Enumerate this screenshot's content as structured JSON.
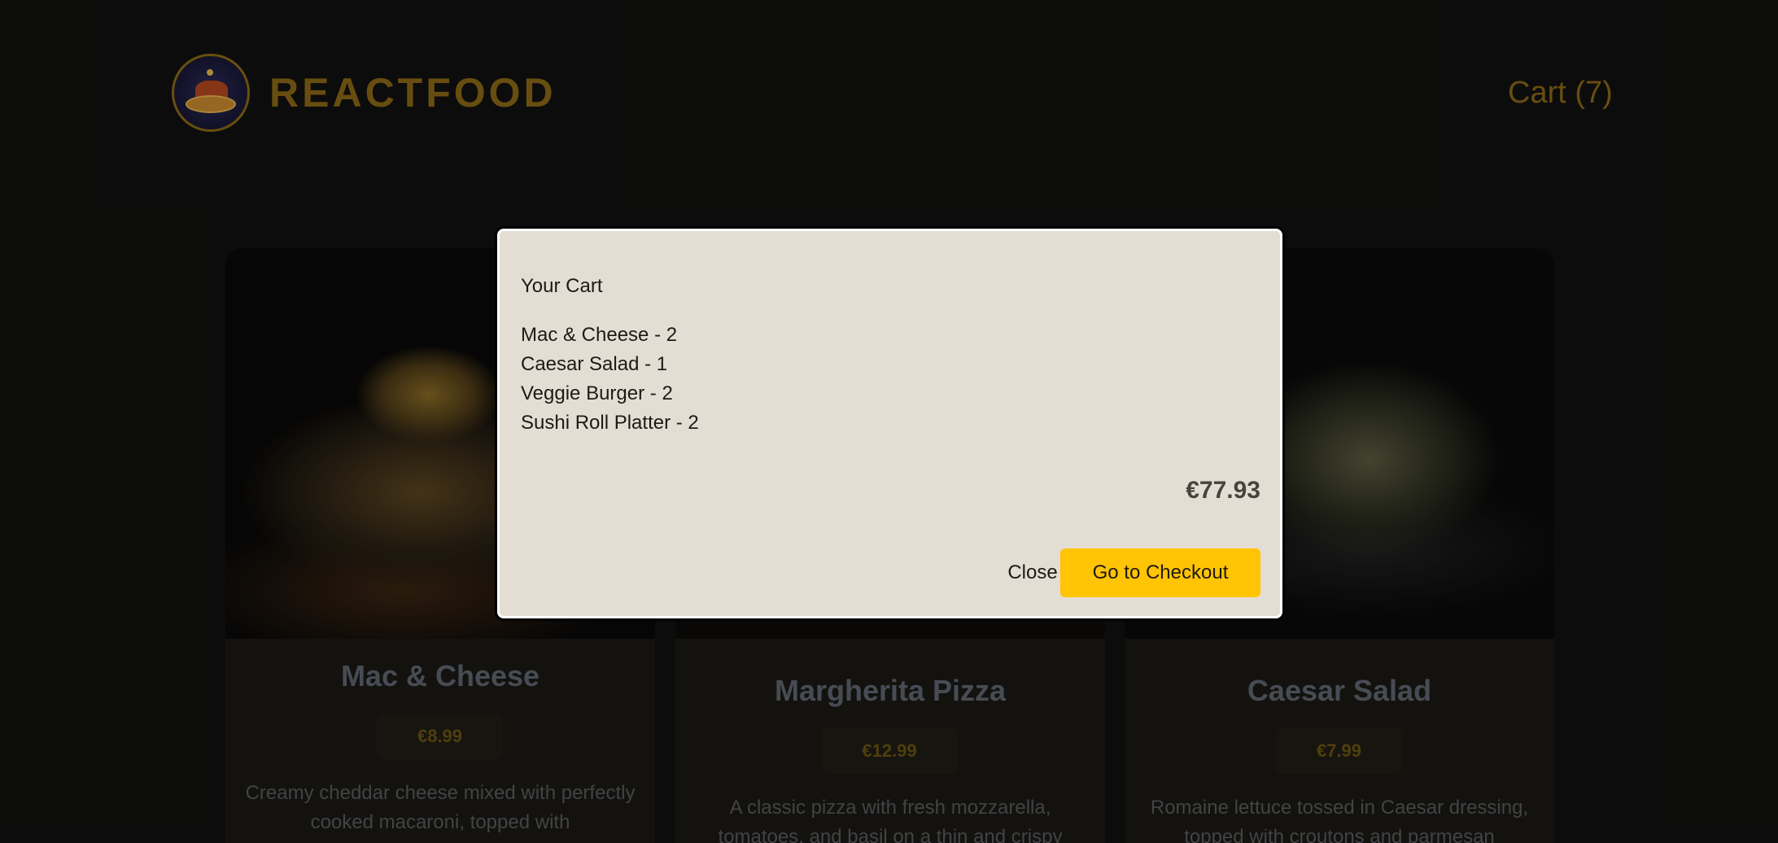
{
  "header": {
    "brand": "REACTFOOD",
    "logo_icon": "restaurant-logo-icon",
    "cart_label": "Cart (7)"
  },
  "meals": [
    {
      "name": "Mac & Cheese",
      "price": "€8.99",
      "description": "Creamy cheddar cheese mixed with perfectly cooked macaroni, topped with"
    },
    {
      "name": "Margherita Pizza",
      "price": "€12.99",
      "description": "A classic pizza with fresh mozzarella, tomatoes, and basil on a thin and crispy"
    },
    {
      "name": "Caesar Salad",
      "price": "€7.99",
      "description": "Romaine lettuce tossed in Caesar dressing, topped with croutons and parmesan"
    }
  ],
  "modal": {
    "title": "Your Cart",
    "items": [
      "Mac & Cheese - 2",
      "Caesar Salad - 1",
      "Veggie Burger - 2",
      "Sushi Roll Platter - 2"
    ],
    "total": "€77.93",
    "close_label": "Close",
    "checkout_label": "Go to Checkout"
  },
  "colors": {
    "accent": "#ffc404",
    "brand_gold": "#8a6816",
    "background": "#121110",
    "modal_bg": "#e4ddd3"
  }
}
